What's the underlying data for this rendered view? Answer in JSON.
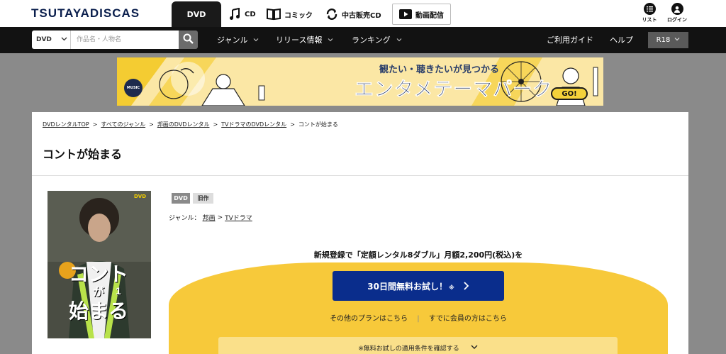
{
  "header": {
    "logo": "TSUTAYADISCAS",
    "tabs": [
      {
        "label": "DVD",
        "active": true
      },
      {
        "label": "CD"
      },
      {
        "label": "コミック"
      },
      {
        "label": "中古販売CD"
      },
      {
        "label": "動画配信"
      }
    ],
    "list_label": "リスト",
    "login_label": "ログイン"
  },
  "nav": {
    "search_category": "DVD",
    "search_placeholder": "作品名・人物名",
    "items": [
      {
        "label": "ジャンル"
      },
      {
        "label": "リリース情報"
      },
      {
        "label": "ランキング"
      }
    ],
    "guide": "ご利用ガイド",
    "help": "ヘルプ",
    "r18": "R18"
  },
  "banner": {
    "tagline": "観たい・聴きたいが見つかる",
    "headline": "エンタメテーマパーク",
    "music_label": "MUSIC",
    "go_label": "GO!"
  },
  "breadcrumb": [
    "DVDレンタルTOP",
    "すべてのジャンル",
    "邦画のDVDレンタル",
    "TVドラマのDVDレンタル",
    "コントが始まる"
  ],
  "product": {
    "title": "コントが始まる",
    "badges": [
      "DVD",
      "旧作"
    ],
    "genre_label": "ジャンル：",
    "genres": [
      "邦画",
      "TVドラマ"
    ],
    "poster_title_1": "コント",
    "poster_title_2": "が",
    "poster_title_3": "始まる",
    "poster_badge": "DVD",
    "poster_number": "1"
  },
  "promo": {
    "text": "新規登録で「定額レンタル8ダブル」月額2,200円(税込)を",
    "button_label": "30日間無料お試し！",
    "button_note": "※",
    "other_plans": "その他のプランはこちら",
    "member_link": "すでに会員の方はこちら",
    "conditions": "※無料お試しの適用条件を確認する"
  },
  "colors": {
    "primary_blue": "#0a2d8c",
    "promo_yellow": "#f7c93a",
    "navbar": "#121212"
  }
}
